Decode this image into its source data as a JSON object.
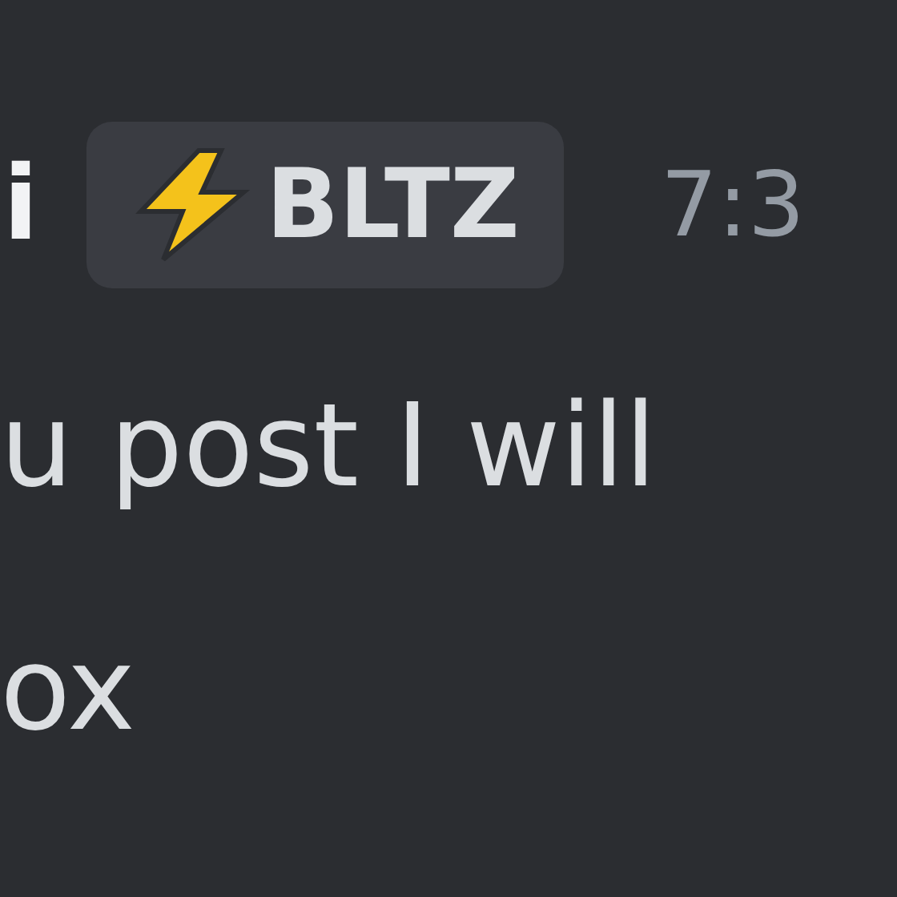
{
  "message": {
    "author": "i",
    "badge": {
      "label": "BLTZ"
    },
    "time": "7:3",
    "lines": [
      "u post I will",
      "ox"
    ]
  }
}
